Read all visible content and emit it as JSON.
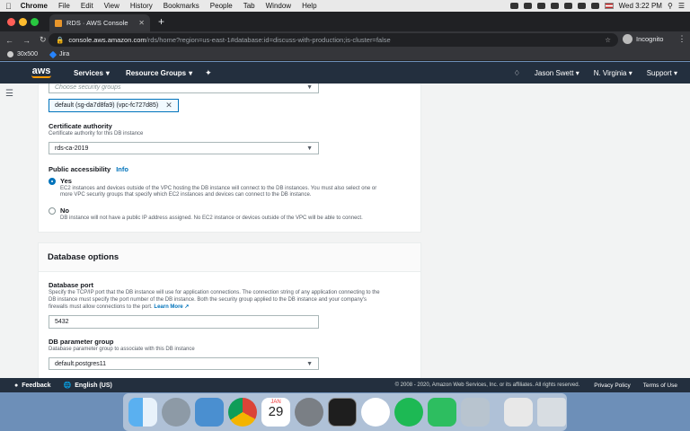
{
  "menubar": {
    "apple": "",
    "items": [
      "Chrome",
      "File",
      "Edit",
      "View",
      "History",
      "Bookmarks",
      "People",
      "Tab",
      "Window",
      "Help"
    ],
    "clock": "Wed 3:22 PM"
  },
  "browser": {
    "tab_title": "RDS · AWS Console",
    "new_tab": "+",
    "url_host": "console.aws.amazon.com",
    "url_path": "/rds/home?region=us-east-1#database:id=discuss-with-production;is-cluster=false",
    "incognito_label": "Incognito",
    "bookmarks": [
      "30x500",
      "Jira"
    ]
  },
  "aws_nav": {
    "logo": "aws",
    "services": "Services",
    "resource_groups": "Resource Groups",
    "user": "Jason Swett",
    "region": "N. Virginia",
    "support": "Support"
  },
  "connectivity": {
    "security_groups_placeholder": "Choose security groups",
    "security_group_token": "default (sg-da7d8fa9) (vpc-fc727d85)",
    "ca_label": "Certificate authority",
    "ca_desc": "Certificate authority for this DB instance",
    "ca_value": "rds-ca-2019",
    "public_label": "Public accessibility",
    "info": "Info",
    "yes_label": "Yes",
    "yes_desc_1": "EC2 instances and devices outside of the VPC hosting the DB instance will connect to the DB instances. You must also select one or",
    "yes_desc_2": "more VPC security groups that specify which EC2 instances and devices can connect to the DB instance.",
    "no_label": "No",
    "no_desc": "DB instance will not have a public IP address assigned. No EC2 instance or devices outside of the VPC will be able to connect.",
    "selected": "Yes"
  },
  "database_options": {
    "header": "Database options",
    "port_label": "Database port",
    "port_desc_1": "Specify the TCP/IP port that the DB instance will use for application connections. The connection string of any application connecting to the",
    "port_desc_2": "DB instance must specify the port number of the DB instance. Both the security group applied to the DB instance and your company's",
    "port_desc_3": "firewalls must allow connections to the port.",
    "learn_more": "Learn More",
    "port_value": "5432",
    "param_label": "DB parameter group",
    "param_desc": "Database parameter group to associate with this DB instance",
    "param_value": "default.postgres11"
  },
  "footer": {
    "feedback": "Feedback",
    "language": "English (US)",
    "copyright": "© 2008 - 2020, Amazon Web Services, Inc. or its affiliates. All rights reserved.",
    "privacy": "Privacy Policy",
    "terms": "Terms of Use"
  },
  "dock": {
    "calendar_month": "JAN",
    "calendar_day": "29"
  },
  "colors": {
    "aws_nav_bg": "#232f3e",
    "aws_orange": "#ff9900",
    "link_blue": "#0073bb",
    "highlight_red": "#e02d1f"
  }
}
